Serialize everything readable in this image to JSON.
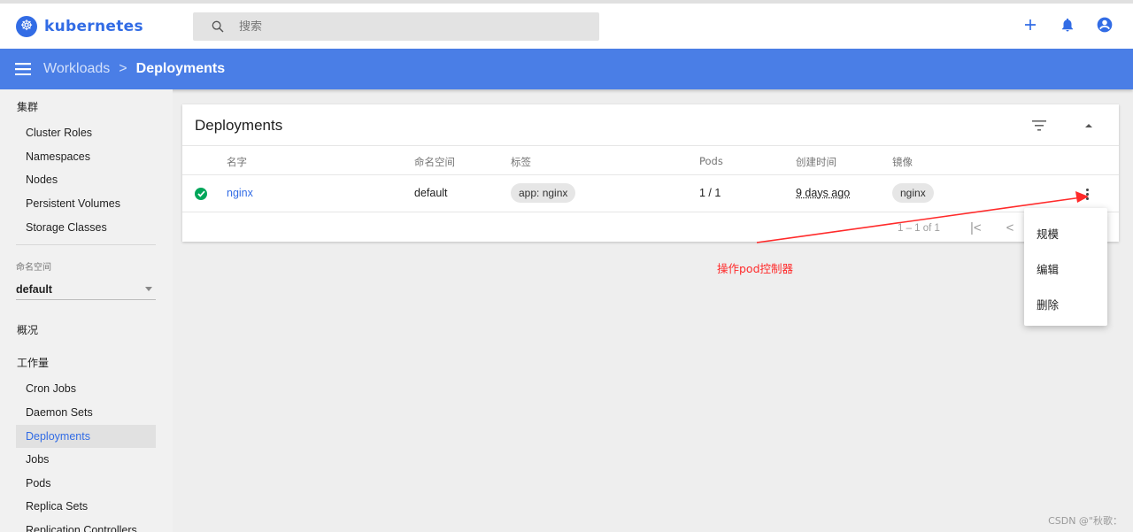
{
  "app": {
    "logo_mark": "☸",
    "logo_text": "kubernetes"
  },
  "search": {
    "placeholder": "搜索",
    "value": ""
  },
  "header_actions": {
    "icons": [
      "plus-icon",
      "bell-icon",
      "account-icon"
    ]
  },
  "breadcrumb": {
    "parent": "Workloads",
    "separator": ">",
    "current": "Deployments"
  },
  "sidebar": {
    "cluster_title": "集群",
    "cluster_items": [
      "Cluster Roles",
      "Namespaces",
      "Nodes",
      "Persistent Volumes",
      "Storage Classes"
    ],
    "namespace_label": "命名空间",
    "namespace_value": "default",
    "overview": "概况",
    "workloads_title": "工作量",
    "workload_items": [
      "Cron Jobs",
      "Daemon Sets",
      "Deployments",
      "Jobs",
      "Pods",
      "Replica Sets",
      "Replication Controllers"
    ],
    "active_item": "Deployments"
  },
  "card": {
    "title": "Deployments",
    "columns": [
      "名字",
      "命名空间",
      "标签",
      "Pods",
      "创建时间",
      "镜像"
    ],
    "rows": [
      {
        "status": "running",
        "name": "nginx",
        "namespace": "default",
        "label": "app: nginx",
        "pods": "1 / 1",
        "created": "9 days ago",
        "image": "nginx"
      }
    ],
    "pagination": "1 – 1 of 1"
  },
  "context_menu": {
    "items": [
      "规模",
      "编辑",
      "删除"
    ]
  },
  "annotation": {
    "text": "操作pod控制器",
    "color": "#ff2a2a"
  },
  "watermark": "CSDN @\"秋歌：",
  "colors": {
    "brand": "#326ce5",
    "navbar": "#4a7ee6",
    "success": "#00a65a"
  }
}
